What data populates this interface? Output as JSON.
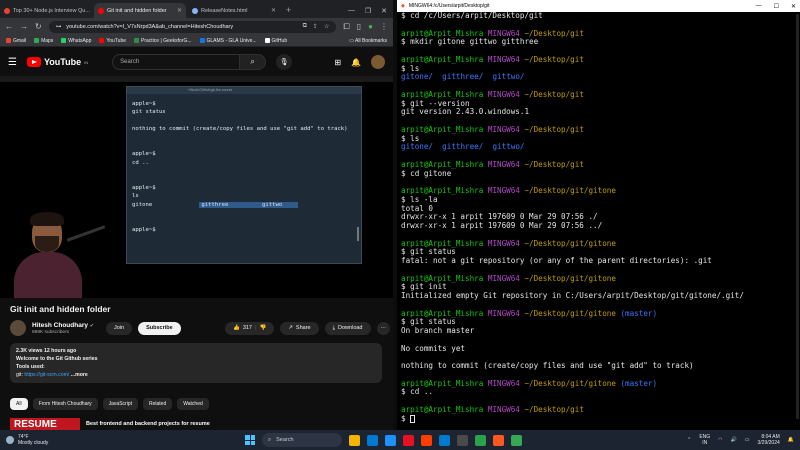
{
  "browser": {
    "tabs": [
      {
        "title": "Top 30+ Node.js Interview Qu...",
        "color": "#e94235",
        "active": false
      },
      {
        "title": "Git init and hidden folder",
        "color": "#ff0000",
        "active": true
      },
      {
        "title": "ReleaseNotes.html",
        "color": "#8ab4f8",
        "active": false
      }
    ],
    "url": "youtube.com/watch?v=I_V7sNrpd3A&ab_channel=HiteshChoudhary",
    "bookmarks": [
      {
        "label": "Gmail",
        "color": "#ea4335"
      },
      {
        "label": "Maps",
        "color": "#34a853"
      },
      {
        "label": "WhatsApp",
        "color": "#25d366"
      },
      {
        "label": "YouTube",
        "color": "#ff0000"
      },
      {
        "label": "Practice | GeeksforG...",
        "color": "#2f8d46"
      },
      {
        "label": "GLAMS - GLA Unive...",
        "color": "#1a73e8"
      },
      {
        "label": "GitHub",
        "color": "#ffffff"
      }
    ],
    "all_bookmarks": "All Bookmarks"
  },
  "youtube": {
    "logo": "YouTube",
    "logo_region": "IN",
    "search_placeholder": "Search",
    "video_terminal": {
      "header": "~/Work/GitHub/git-the-course",
      "lines_1": "apple~$\ngit status\n\nnothing to commit (create/copy files and use \"git add\" to track)\n\n\napple~$\ncd ..\n\n\napple~$\nls",
      "ls_line": "gitone",
      "ls_dir1": "gitthree",
      "ls_dir2": "gittwo",
      "lines_2": "apple~$"
    },
    "video_title": "Git init and hidden folder",
    "channel_name": "Hitesh Choudhary",
    "channel_subs": "868K subscribers",
    "join_label": "Join",
    "subscribe_label": "Subscribe",
    "likes": "317",
    "share_label": "Share",
    "download_label": "Download",
    "description": {
      "stats": "2.3K views  12 hours ago",
      "line1": "Welcome to the Git Github series",
      "line2": "Tools used:",
      "line3_prefix": "git: ",
      "link": "https://git-scm.com/",
      "more": "...more"
    },
    "chips": [
      "All",
      "From Hitesh Choudhary",
      "JavaScript",
      "Related",
      "Watched"
    ],
    "rec_thumb_text": "RESUME",
    "rec_title": "Best frontend and backend projects for resume"
  },
  "terminal": {
    "title": "MINGW64:/c/Users/arpit/Desktop/git",
    "user": "arpit@Arpit_Mishra",
    "host": "MINGW64",
    "blocks": [
      {
        "path": "",
        "branch": "",
        "lines": [
          "$ cd /c/Users/arpit/Desktop/git"
        ],
        "prompt_only_cmd": true
      },
      {
        "path": "~/Desktop/git",
        "branch": "",
        "lines": [
          "$ mkdir gitone gittwo gitthree"
        ]
      },
      {
        "path": "~/Desktop/git",
        "branch": "",
        "lines": [
          "$ ls"
        ],
        "dirs": [
          "gitone/",
          "gitthree/",
          "gittwo/"
        ]
      },
      {
        "path": "~/Desktop/git",
        "branch": "",
        "lines": [
          "$ git --version",
          "git version 2.43.0.windows.1"
        ]
      },
      {
        "path": "~/Desktop/git",
        "branch": "",
        "lines": [
          "$ ls"
        ],
        "dirs": [
          "gitone/",
          "gitthree/",
          "gittwo/"
        ]
      },
      {
        "path": "~/Desktop/git",
        "branch": "",
        "lines": [
          "$ cd gitone"
        ]
      },
      {
        "path": "~/Desktop/git/gitone",
        "branch": "",
        "lines": [
          "$ ls -la",
          "total 0",
          "drwxr-xr-x 1 arpit 197609 0 Mar 29 07:56 ./",
          "drwxr-xr-x 1 arpit 197609 0 Mar 29 07:56 ../"
        ]
      },
      {
        "path": "~/Desktop/git/gitone",
        "branch": "",
        "lines": [
          "$ git status",
          "fatal: not a git repository (or any of the parent directories): .git"
        ]
      },
      {
        "path": "~/Desktop/git/gitone",
        "branch": "",
        "lines": [
          "$ git init",
          "Initialized empty Git repository in C:/Users/arpit/Desktop/git/gitone/.git/"
        ]
      },
      {
        "path": "~/Desktop/git/gitone",
        "branch": "(master)",
        "lines": [
          "$ git status",
          "On branch master",
          "",
          "No commits yet",
          "",
          "nothing to commit (create/copy files and use \"git add\" to track)"
        ]
      },
      {
        "path": "~/Desktop/git/gitone",
        "branch": "(master)",
        "lines": [
          "$ cd .."
        ]
      },
      {
        "path": "~/Desktop/git",
        "branch": "",
        "lines": [
          "$ "
        ],
        "cursor": true
      }
    ]
  },
  "taskbar": {
    "temp": "74°F",
    "weather": "Mostly cloudy",
    "search": "Search",
    "lang": "ENG",
    "region": "IN",
    "time": "8:04 AM",
    "date": "3/29/2024",
    "apps": [
      "#f4b400",
      "#0078d4",
      "#1e90ff",
      "#e81123",
      "#ff3d00",
      "#007acc",
      "#4a4a4a",
      "#2aa24c",
      "#ff5722",
      "#34a853"
    ]
  }
}
